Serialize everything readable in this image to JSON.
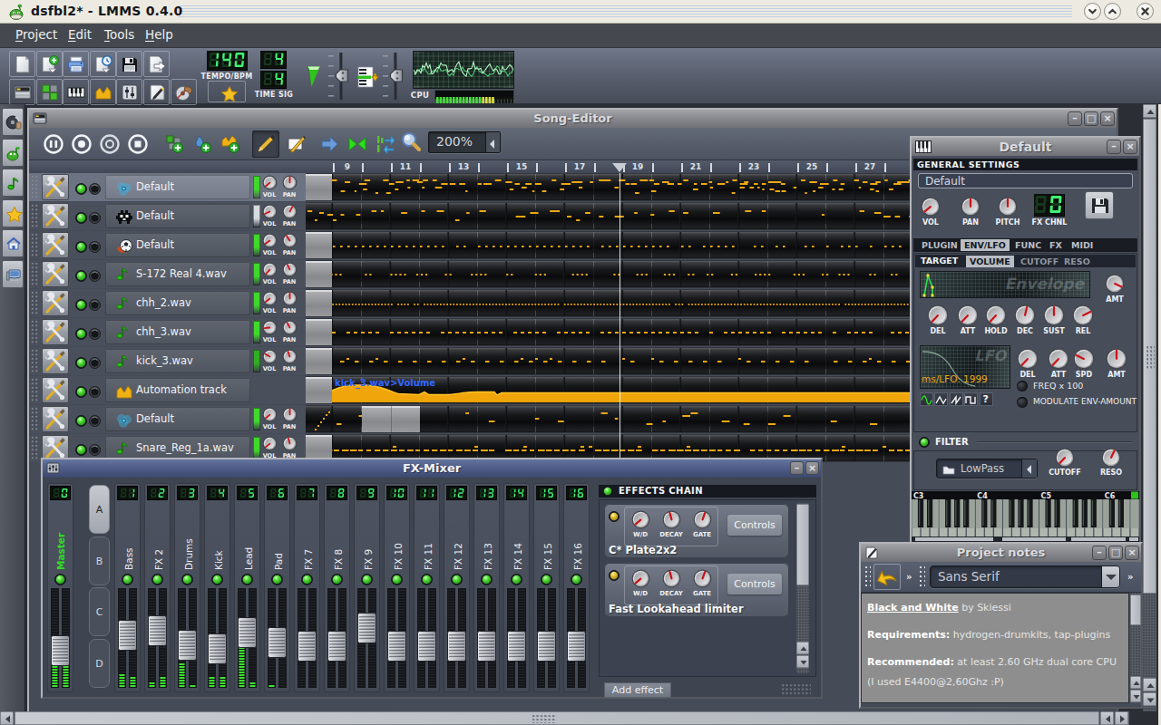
{
  "window": {
    "title": "dsfbl2* - LMMS 0.4.0",
    "controls": {
      "minimize": "chevron-down",
      "maximize": "chevron-up",
      "close": "x"
    }
  },
  "menu": {
    "items": [
      {
        "label": "Project"
      },
      {
        "label": "Edit"
      },
      {
        "label": "Tools"
      },
      {
        "label": "Help"
      }
    ]
  },
  "toolbar": {
    "row1": [
      {
        "name": "new-project",
        "icon": "page"
      },
      {
        "name": "open-project",
        "icon": "page-plus"
      },
      {
        "name": "open-recent",
        "icon": "printer"
      },
      {
        "name": "recently-opened",
        "icon": "page-clock"
      },
      {
        "name": "save-project",
        "icon": "floppy"
      },
      {
        "name": "export-project",
        "icon": "page-arrow"
      }
    ],
    "row2": [
      {
        "name": "song-editor-toggle",
        "icon": "songed"
      },
      {
        "name": "bb-editor-toggle",
        "icon": "bb"
      },
      {
        "name": "piano-roll-toggle",
        "icon": "piano"
      },
      {
        "name": "automation-editor-toggle",
        "icon": "automation"
      },
      {
        "name": "fx-mixer-toggle",
        "icon": "mixer"
      },
      {
        "name": "project-notes-toggle",
        "icon": "notes"
      },
      {
        "name": "controller-rack-toggle",
        "icon": "controller"
      }
    ],
    "tempo": {
      "value": "140",
      "label": "TEMPO/BPM"
    },
    "whatsthis": {
      "icon": "star"
    },
    "timesig": {
      "numerator": "4",
      "denominator": "4",
      "label": "TIME SIG"
    },
    "master_volume": {
      "icon": "volume-triangle"
    },
    "master_pitch": {
      "icon": "pitch-lines"
    },
    "cpu": {
      "label": "CPU",
      "segments_lit": 14,
      "segments_yellow": 4,
      "segments_total": 24
    }
  },
  "sidebar": {
    "items": [
      {
        "name": "instrument-plugins",
        "icon": "disc"
      },
      {
        "name": "my-projects",
        "icon": "creature"
      },
      {
        "name": "samples",
        "icon": "note"
      },
      {
        "name": "presets",
        "icon": "star"
      },
      {
        "name": "home",
        "icon": "home"
      },
      {
        "name": "computer",
        "icon": "computer"
      }
    ]
  },
  "song_editor": {
    "title": "Song-Editor",
    "toolbar": [
      {
        "name": "play",
        "icon": "pause-circle"
      },
      {
        "name": "record",
        "icon": "record-circle"
      },
      {
        "name": "record-play",
        "icon": "record-circle2"
      },
      {
        "name": "stop",
        "icon": "stop-circle"
      },
      {
        "name": "add-bb-track",
        "icon": "add-bb"
      },
      {
        "name": "add-sample-track",
        "icon": "add-sample"
      },
      {
        "name": "add-automation-track",
        "icon": "add-automation"
      },
      {
        "name": "draw-mode",
        "icon": "pencil",
        "selected": true
      },
      {
        "name": "edit-mode",
        "icon": "edit-erase"
      },
      {
        "name": "jump-playhead",
        "icon": "arrow-blue"
      },
      {
        "name": "back-to-start",
        "icon": "bowtie"
      },
      {
        "name": "track-io",
        "icon": "arrows-io"
      }
    ],
    "zoom": {
      "icon": "magnifier",
      "value": "200%"
    },
    "timeline": {
      "numbers": [
        9,
        11,
        13,
        15,
        17,
        19,
        21,
        23,
        25,
        27
      ],
      "playhead_bar": 18.8
    },
    "vol_label": "VOL",
    "pan_label": "PAN",
    "tracks": [
      {
        "name": "Default",
        "icon": "tripleosc",
        "selected": true,
        "volbar": "#3fd82b",
        "vol": -132,
        "pan": 0,
        "pattern": "melody-a",
        "gray_start": true
      },
      {
        "name": "Default",
        "icon": "bitinvader",
        "selected": false,
        "volbar": "#d7dbe0",
        "vol": -115,
        "pan": 28,
        "pattern": "melody-b",
        "gray_start": false
      },
      {
        "name": "Default",
        "icon": "kicker",
        "selected": false,
        "volbar": "#3fd82b",
        "vol": -125,
        "pan": -35,
        "pattern": "beat-dots",
        "gray_start": true
      },
      {
        "name": "S-172 Real 4.wav",
        "icon": "note",
        "selected": false,
        "volbar": "#3fd82b",
        "vol": -138,
        "pan": -25,
        "pattern": "dots-b",
        "gray_start": true
      },
      {
        "name": "chh_2.wav",
        "icon": "note",
        "selected": false,
        "volbar": "#3fd82b",
        "vol": -128,
        "pan": 0,
        "pattern": "dots-dense",
        "gray_start": true
      },
      {
        "name": "chh_3.wav",
        "icon": "note",
        "selected": false,
        "volbar": "#3fd82b",
        "vol": -95,
        "pan": -28,
        "pattern": "dash-a",
        "gray_start": true
      },
      {
        "name": "kick_3.wav",
        "icon": "note",
        "selected": false,
        "volbar": "#2fae22",
        "vol": -60,
        "pan": -20,
        "pattern": "dash-b",
        "gray_start": true
      },
      {
        "name": "Automation track",
        "icon": "automation",
        "selected": false,
        "volbar": null,
        "vol": null,
        "pan": null,
        "pattern": "automation",
        "gray_start": true,
        "pattern_label": "kick_3.wav>Volume"
      },
      {
        "name": "Default",
        "icon": "tripleosc",
        "selected": false,
        "volbar": "#3fd82b",
        "vol": -132,
        "pan": 0,
        "pattern": "melody-c",
        "gray_start": false
      },
      {
        "name": "Snare_Reg_1a.wav",
        "icon": "note",
        "selected": false,
        "volbar": "#3fd82b",
        "vol": -130,
        "pan": -15,
        "pattern": "dash-c",
        "gray_start": true
      }
    ]
  },
  "fx_mixer": {
    "title": "FX-Mixer",
    "banks": [
      "A",
      "B",
      "C",
      "D"
    ],
    "active_bank": "A",
    "channels": [
      {
        "num": 0,
        "label": "Master",
        "label_color": "#2ee01e",
        "fader": 67,
        "vu_l": 0.4,
        "vu_r": 0.45
      },
      {
        "num": 1,
        "label": "Bass",
        "fader": 45,
        "vu_l": 0.15,
        "vu_r": 0.12
      },
      {
        "num": 2,
        "label": "FX 2",
        "fader": 38,
        "vu_l": 0.05,
        "vu_r": 0.1
      },
      {
        "num": 3,
        "label": "Drums",
        "fader": 59,
        "vu_l": 0.26,
        "vu_r": 0.04
      },
      {
        "num": 4,
        "label": "Kick",
        "fader": 64,
        "vu_l": 0.1,
        "vu_r": 0.12
      },
      {
        "num": 5,
        "label": "Lead",
        "fader": 41,
        "vu_l": 0.42,
        "vu_r": 0.05
      },
      {
        "num": 6,
        "label": "Pad",
        "fader": 55,
        "vu_l": 0.03,
        "vu_r": 0.0
      },
      {
        "num": 7,
        "label": "FX 7",
        "fader": 60,
        "vu_l": 0,
        "vu_r": 0
      },
      {
        "num": 8,
        "label": "FX 8",
        "fader": 60,
        "vu_l": 0,
        "vu_r": 0
      },
      {
        "num": 9,
        "label": "FX 9",
        "fader": 35,
        "vu_l": 0,
        "vu_r": 0
      },
      {
        "num": 10,
        "label": "FX 10",
        "fader": 60,
        "vu_l": 0,
        "vu_r": 0
      },
      {
        "num": 11,
        "label": "FX 11",
        "fader": 60,
        "vu_l": 0,
        "vu_r": 0
      },
      {
        "num": 12,
        "label": "FX 12",
        "fader": 60,
        "vu_l": 0,
        "vu_r": 0
      },
      {
        "num": 13,
        "label": "FX 13",
        "fader": 60,
        "vu_l": 0,
        "vu_r": 0
      },
      {
        "num": 14,
        "label": "FX 14",
        "fader": 60,
        "vu_l": 0,
        "vu_r": 0
      },
      {
        "num": 15,
        "label": "FX 15",
        "fader": 60,
        "vu_l": 0,
        "vu_r": 0
      },
      {
        "num": 16,
        "label": "FX 16",
        "fader": 60,
        "vu_l": 0,
        "vu_r": 0
      }
    ],
    "effects": {
      "header": "EFFECTS CHAIN",
      "slots": [
        {
          "knobs": [
            "W/D",
            "DECAY",
            "GATE"
          ],
          "button": "Controls",
          "name": "C* Plate2x2"
        },
        {
          "knobs": [
            "W/D",
            "DECAY",
            "GATE"
          ],
          "button": "Controls",
          "name": "Fast Lookahead limiter"
        }
      ],
      "add_button": "Add effect"
    }
  },
  "instrument": {
    "title": "Default",
    "general_header": "GENERAL SETTINGS",
    "name_value": "Default",
    "knobs": [
      {
        "label": "VOL",
        "angle": -130
      },
      {
        "label": "PAN",
        "angle": 0
      },
      {
        "label": "PITCH",
        "angle": 0
      }
    ],
    "fx_chnl": {
      "value": "0",
      "label": "FX CHNL"
    },
    "save_icon": "floppy",
    "tabs": [
      "PLUGIN",
      "ENV/LFO",
      "FUNC",
      "FX",
      "MIDI"
    ],
    "active_tab": "ENV/LFO",
    "target": {
      "label": "TARGET",
      "options": [
        "VOLUME",
        "CUTOFF",
        "RESO"
      ],
      "active": "VOLUME"
    },
    "envelope": {
      "watermark": "Envelope",
      "amt": {
        "label": "AMT",
        "angle": 115
      }
    },
    "env_knobs": [
      {
        "label": "DEL",
        "angle": -137
      },
      {
        "label": "ATT",
        "angle": -137
      },
      {
        "label": "HOLD",
        "angle": -137
      },
      {
        "label": "DEC",
        "angle": 14
      },
      {
        "label": "SUST",
        "angle": 0
      },
      {
        "label": "REL",
        "angle": 65
      }
    ],
    "lfo": {
      "watermark": "LFO",
      "ms_label": "ms/LFO: 1999",
      "shapes": [
        "sine",
        "triangle",
        "saw",
        "square",
        "custom"
      ],
      "knobs": [
        {
          "label": "DEL",
          "angle": -137
        },
        {
          "label": "ATT",
          "angle": -137
        },
        {
          "label": "SPD",
          "angle": -65
        },
        {
          "label": "AMT",
          "angle": 0
        }
      ],
      "freq_label": "FREQ x 100",
      "mod_label": "MODULATE ENV-AMOUNT"
    },
    "filter": {
      "label": "FILTER",
      "value": "LowPass",
      "knobs": [
        {
          "label": "CUTOFF",
          "angle": -137
        },
        {
          "label": "RESO",
          "angle": 25
        }
      ]
    },
    "piano": {
      "octaves": [
        "C3",
        "C4",
        "C5",
        "C6"
      ]
    }
  },
  "project_notes": {
    "title": "Project notes",
    "undo_icon": "undo-arrow",
    "font_combo": "Sans Serif",
    "lines": [
      {
        "bold": "Black and White",
        "underline": true,
        "rest": " by Skiessi"
      },
      {
        "bold": "",
        "rest": ""
      },
      {
        "bold": "Requirements:",
        "underline": false,
        "rest": " hydrogen-drumkits, tap-plugins"
      },
      {
        "bold": "",
        "rest": ""
      },
      {
        "bold": "Recommended:",
        "underline": false,
        "rest": " at least 2.60 GHz dual core CPU (I used E4400@2,60Ghz :P)"
      }
    ]
  }
}
